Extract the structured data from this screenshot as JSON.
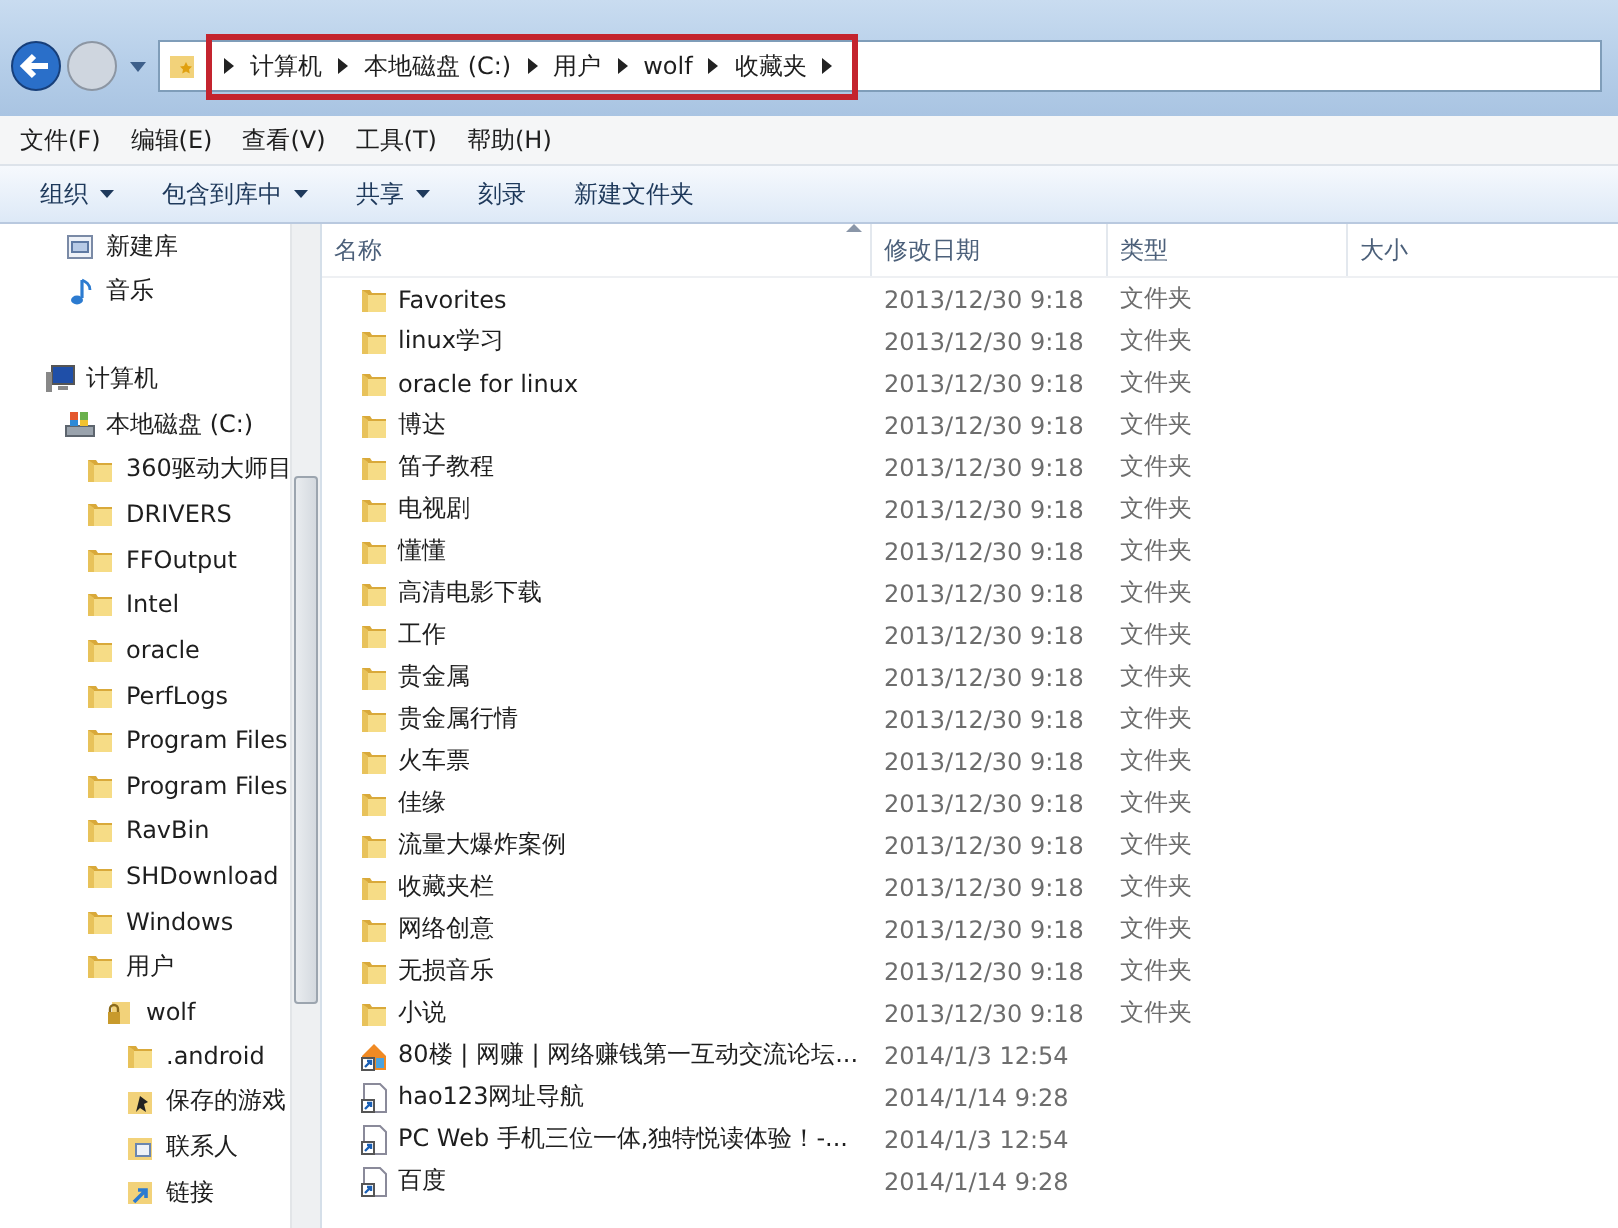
{
  "address_bar": {
    "highlighted": true,
    "crumbs": [
      "计算机",
      "本地磁盘 (C:)",
      "用户",
      "wolf",
      "收藏夹"
    ]
  },
  "menu": [
    "文件(F)",
    "编辑(E)",
    "查看(V)",
    "工具(T)",
    "帮助(H)"
  ],
  "toolbar": [
    {
      "label": "组织",
      "has_menu": true
    },
    {
      "label": "包含到库中",
      "has_menu": true
    },
    {
      "label": "共享",
      "has_menu": true
    },
    {
      "label": "刻录",
      "has_menu": false
    },
    {
      "label": "新建文件夹",
      "has_menu": false
    }
  ],
  "nav": [
    {
      "label": "新建库",
      "kind": "library"
    },
    {
      "label": "音乐",
      "kind": "music"
    },
    {
      "label": "计算机",
      "kind": "computer",
      "children": [
        {
          "label": "本地磁盘 (C:)",
          "kind": "drive",
          "children": [
            {
              "label": "360驱动大师目",
              "kind": "folder"
            },
            {
              "label": "DRIVERS",
              "kind": "folder"
            },
            {
              "label": "FFOutput",
              "kind": "folder"
            },
            {
              "label": "Intel",
              "kind": "folder"
            },
            {
              "label": "oracle",
              "kind": "folder"
            },
            {
              "label": "PerfLogs",
              "kind": "folder"
            },
            {
              "label": "Program Files",
              "kind": "folder"
            },
            {
              "label": "Program Files",
              "kind": "folder"
            },
            {
              "label": "RavBin",
              "kind": "folder"
            },
            {
              "label": "SHDownload",
              "kind": "folder"
            },
            {
              "label": "Windows",
              "kind": "folder"
            },
            {
              "label": "用户",
              "kind": "folder",
              "children": [
                {
                  "label": "wolf",
                  "kind": "user",
                  "children": [
                    {
                      "label": ".android",
                      "kind": "folder"
                    },
                    {
                      "label": "保存的游戏",
                      "kind": "games"
                    },
                    {
                      "label": "联系人",
                      "kind": "contacts"
                    },
                    {
                      "label": "链接",
                      "kind": "links"
                    }
                  ]
                }
              ]
            }
          ]
        }
      ]
    }
  ],
  "columns": [
    {
      "label": "名称",
      "sorted": true
    },
    {
      "label": "修改日期",
      "sorted": false
    },
    {
      "label": "类型",
      "sorted": false
    },
    {
      "label": "大小",
      "sorted": false
    }
  ],
  "rows": [
    {
      "kind": "folder",
      "name": "Favorites",
      "date": "2013/12/30 9:18",
      "type": "文件夹"
    },
    {
      "kind": "folder",
      "name": "linux学习",
      "date": "2013/12/30 9:18",
      "type": "文件夹"
    },
    {
      "kind": "folder",
      "name": "oracle for linux",
      "date": "2013/12/30 9:18",
      "type": "文件夹"
    },
    {
      "kind": "folder",
      "name": "博达",
      "date": "2013/12/30 9:18",
      "type": "文件夹"
    },
    {
      "kind": "folder",
      "name": "笛子教程",
      "date": "2013/12/30 9:18",
      "type": "文件夹"
    },
    {
      "kind": "folder",
      "name": "电视剧",
      "date": "2013/12/30 9:18",
      "type": "文件夹"
    },
    {
      "kind": "folder",
      "name": "懂懂",
      "date": "2013/12/30 9:18",
      "type": "文件夹"
    },
    {
      "kind": "folder",
      "name": "高清电影下载",
      "date": "2013/12/30 9:18",
      "type": "文件夹"
    },
    {
      "kind": "folder",
      "name": "工作",
      "date": "2013/12/30 9:18",
      "type": "文件夹"
    },
    {
      "kind": "folder",
      "name": "贵金属",
      "date": "2013/12/30 9:18",
      "type": "文件夹"
    },
    {
      "kind": "folder",
      "name": "贵金属行情",
      "date": "2013/12/30 9:18",
      "type": "文件夹"
    },
    {
      "kind": "folder",
      "name": "火车票",
      "date": "2013/12/30 9:18",
      "type": "文件夹"
    },
    {
      "kind": "folder",
      "name": "佳缘",
      "date": "2013/12/30 9:18",
      "type": "文件夹"
    },
    {
      "kind": "folder",
      "name": "流量大爆炸案例",
      "date": "2013/12/30 9:18",
      "type": "文件夹"
    },
    {
      "kind": "folder",
      "name": "收藏夹栏",
      "date": "2013/12/30 9:18",
      "type": "文件夹"
    },
    {
      "kind": "folder",
      "name": "网络创意",
      "date": "2013/12/30 9:18",
      "type": "文件夹"
    },
    {
      "kind": "folder",
      "name": "无损音乐",
      "date": "2013/12/30 9:18",
      "type": "文件夹"
    },
    {
      "kind": "folder",
      "name": "小说",
      "date": "2013/12/30 9:18",
      "type": "文件夹"
    },
    {
      "kind": "site-shortcut",
      "name": "80楼 | 网赚 | 网络赚钱第一互动交流论坛...",
      "date": "2014/1/3 12:54"
    },
    {
      "kind": "shortcut",
      "name": "hao123网址导航",
      "date": "2014/1/14 9:28"
    },
    {
      "kind": "shortcut",
      "name": "PC Web 手机三位一体,独特悦读体验！-...",
      "date": "2014/1/3 12:54"
    },
    {
      "kind": "shortcut",
      "name": "百度",
      "date": "2014/1/14 9:28"
    }
  ]
}
